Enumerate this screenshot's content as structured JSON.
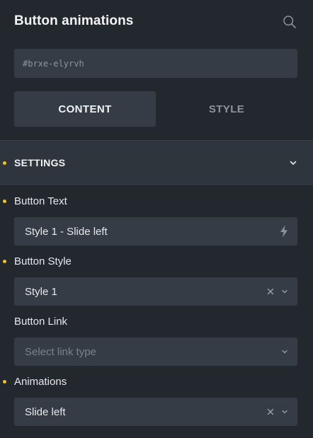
{
  "panel": {
    "title": "Button animations"
  },
  "element_id": {
    "placeholder": "#brxe-elyrvh"
  },
  "tabs": [
    {
      "label": "CONTENT",
      "active": true
    },
    {
      "label": "STYLE",
      "active": false
    }
  ],
  "section": {
    "label": "SETTINGS",
    "expanded": true
  },
  "controls": {
    "button_text": {
      "label": "Button Text",
      "value": "Style 1 - Slide left"
    },
    "button_style": {
      "label": "Button Style",
      "value": "Style 1"
    },
    "button_link": {
      "label": "Button Link",
      "placeholder": "Select link type"
    },
    "animations": {
      "label": "Animations",
      "value": "Slide left"
    }
  },
  "icons": [
    "search-icon",
    "chevron-down-icon",
    "dynamic-data-bolt-icon",
    "clear-x-icon"
  ],
  "colors": {
    "background": "#23272e",
    "field": "#363c45",
    "section_bar": "#2f353d",
    "indicator_dot": "#f2c12e",
    "muted_text": "#8e949c"
  }
}
